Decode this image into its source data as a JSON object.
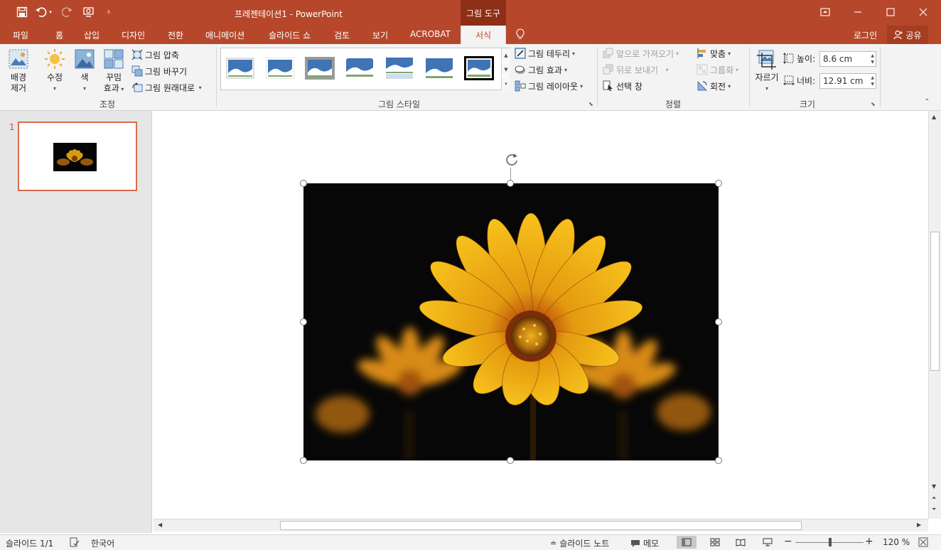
{
  "titlebar": {
    "title": "프레젠테이션1 - PowerPoint",
    "context_tab": "그림 도구",
    "quick_access": [
      "save-icon",
      "undo-icon",
      "redo-icon",
      "touch-mode-icon",
      "customize-icon"
    ],
    "bg_color": "#b7472a"
  },
  "tabs": {
    "file": "파일",
    "home": "홈",
    "insert": "삽입",
    "design": "디자인",
    "transitions": "전환",
    "animations": "애니메이션",
    "slideshow": "슬라이드 쇼",
    "review": "검토",
    "view": "보기",
    "acrobat": "ACROBAT",
    "format": "서식",
    "login": "로그인",
    "share": "공유"
  },
  "ribbon": {
    "adjust": {
      "label": "조정",
      "remove_bg": [
        "배경",
        "제거"
      ],
      "corrections": "수정",
      "color": "색",
      "artistic": [
        "꾸밈",
        "효과"
      ],
      "compress": "그림 압축",
      "change": "그림 바꾸기",
      "reset": "그림 원래대로"
    },
    "styles": {
      "label": "그림 스타일",
      "border": "그림 테두리",
      "effects": "그림 효과",
      "layout": "그림 레이아웃"
    },
    "arrange": {
      "label": "정렬",
      "bring_forward": "앞으로 가져오기",
      "send_backward": "뒤로 보내기",
      "selection_pane": "선택 창",
      "align": "맞춤",
      "group": "그룹화",
      "rotate": "회전"
    },
    "size": {
      "label": "크기",
      "crop": "자르기",
      "height_label": "높이:",
      "height_value": "8.6 cm",
      "width_label": "너비:",
      "width_value": "12.91 cm"
    }
  },
  "slides": {
    "current_number": "1"
  },
  "statusbar": {
    "slide_info": "슬라이드 1/1",
    "language": "한국어",
    "notes": "슬라이드 노트",
    "comments": "메모",
    "zoom": "120 %"
  },
  "colors": {
    "accent": "#b7472a",
    "selected_thumb_border": "#d86c4e"
  }
}
